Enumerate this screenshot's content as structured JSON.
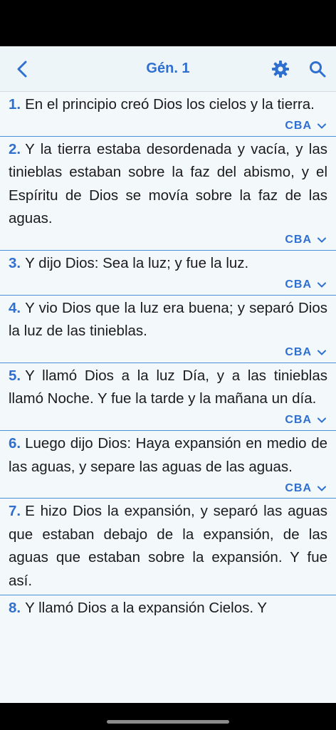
{
  "nav": {
    "title": "Gén. 1",
    "back_icon": "chevron-left-icon",
    "settings_icon": "gear-icon",
    "search_icon": "search-icon"
  },
  "colors": {
    "accent": "#2f6fcf",
    "background": "#f3f8fb",
    "divider": "#4a90d9"
  },
  "verses": [
    {
      "num": "1.",
      "text": "En el principio creó Dios los cielos y la tierra.",
      "version": "CBA"
    },
    {
      "num": "2.",
      "text": "Y la tierra estaba desordenada y vacía, y las tinieblas estaban sobre la faz del abismo, y el Espíritu de Dios se movía sobre la faz de las aguas.",
      "version": "CBA"
    },
    {
      "num": "3.",
      "text": "Y dijo Dios: Sea la luz; y fue la luz.",
      "version": "CBA"
    },
    {
      "num": "4.",
      "text": "Y vio Dios que la luz era buena; y separó Dios la luz de las tinieblas.",
      "version": "CBA"
    },
    {
      "num": "5.",
      "text": "Y llamó Dios a la luz Día, y a las tinieblas llamó Noche. Y fue la tarde y la mañana un día.",
      "version": "CBA"
    },
    {
      "num": "6.",
      "text": "Luego dijo Dios: Haya expansión en medio de las aguas, y separe las aguas de las aguas.",
      "version": "CBA"
    },
    {
      "num": "7.",
      "text": "E hizo Dios la expansión, y separó las aguas que estaban debajo de la expansión, de las aguas que estaban sobre la expansión. Y fue así.",
      "version": ""
    },
    {
      "num": "8.",
      "text": "Y llamó Dios a la expansión Cielos. Y",
      "version": ""
    }
  ]
}
